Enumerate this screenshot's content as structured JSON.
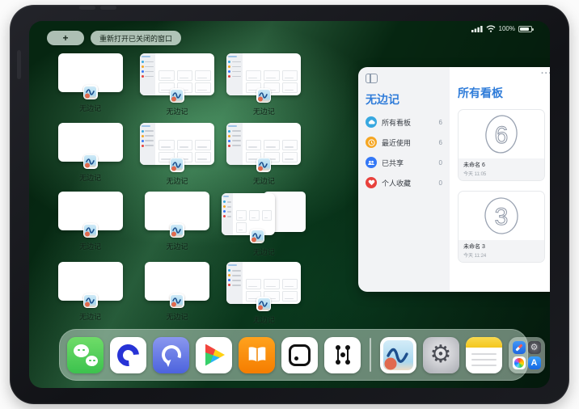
{
  "status_bar": {
    "battery_percent": "100%"
  },
  "toolbar": {
    "new_window_label": "+",
    "reopen_label": "重新打开已关闭的窗口"
  },
  "grid": {
    "windows": [
      {
        "type": "blank",
        "label": "无边记"
      },
      {
        "type": "boards",
        "label": "无边记"
      },
      {
        "type": "boards",
        "label": "无边记"
      },
      {
        "type": "blank",
        "label": "无边记"
      },
      {
        "type": "boards",
        "label": "无边记"
      },
      {
        "type": "boards",
        "label": "无边记"
      },
      {
        "type": "blank",
        "label": "无边记"
      },
      {
        "type": "blank",
        "label": "无边记"
      },
      {
        "type": "stacked",
        "label": "无边记"
      },
      {
        "type": "blank",
        "label": "无边记"
      },
      {
        "type": "blank",
        "label": "无边记"
      },
      {
        "type": "boards",
        "label": "无边记"
      }
    ]
  },
  "panel": {
    "more_label": "···",
    "sidebar": {
      "title": "无边记",
      "items": [
        {
          "label": "所有看板",
          "count": "6",
          "color": "#38a8e0",
          "icon": "cloud-icon"
        },
        {
          "label": "最近使用",
          "count": "6",
          "color": "#f5a623",
          "icon": "clock-icon"
        },
        {
          "label": "已共享",
          "count": "0",
          "color": "#3478f6",
          "icon": "people-icon"
        },
        {
          "label": "个人收藏",
          "count": "0",
          "color": "#e8413c",
          "icon": "heart-icon"
        }
      ]
    },
    "content": {
      "title": "所有看板",
      "boards": [
        {
          "digit": "6",
          "name": "未命名 6",
          "date": "今天 11:05"
        },
        {
          "digit": "3",
          "name": "未命名 3",
          "date": "今天 11:24"
        }
      ]
    }
  },
  "dock": {
    "icons": [
      "wechat-icon",
      "quark-browser-icon",
      "sync-ring-icon",
      "app-market-icon",
      "books-icon",
      "domino-icon",
      "graph-nodes-icon",
      "freeform-icon",
      "settings-gear-icon",
      "notes-icon",
      "apps-folder-icon"
    ]
  },
  "colors": {
    "accent_blue": "#2f7cd9",
    "wallpaper_green": "#0c4724",
    "dock_glass": "rgba(198,222,206,0.52)"
  }
}
